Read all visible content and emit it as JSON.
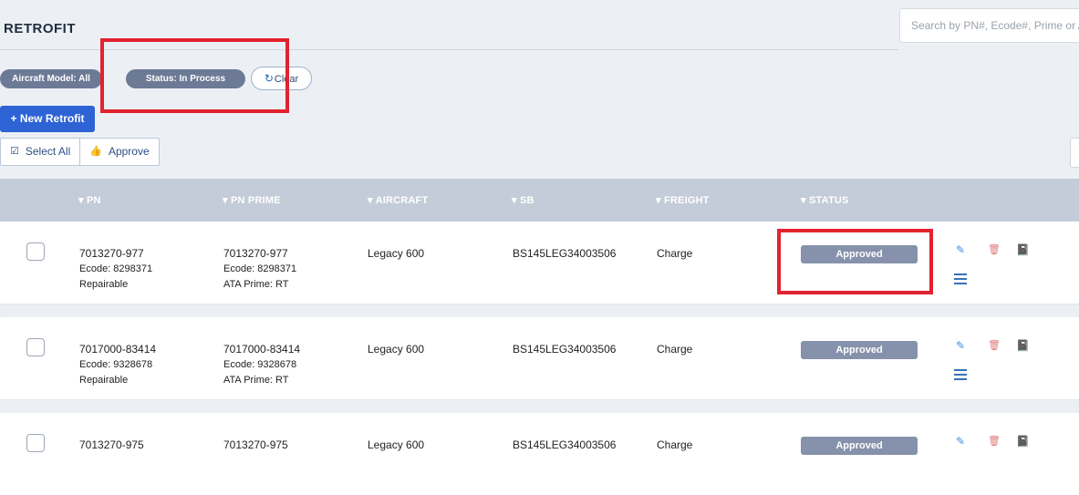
{
  "page_title": "RETROFIT",
  "search": {
    "placeholder": "Search by PN#, Ecode#, Prime or ATA..."
  },
  "filters": {
    "aircraft_model": "Aircraft Model: All",
    "status": "Status: In Process",
    "clear_label": "Clear"
  },
  "buttons": {
    "new_retrofit": "New Retrofit",
    "select_all": "Select All",
    "approve": "Approve"
  },
  "table": {
    "headers": [
      "PN",
      "PN PRIME",
      "AIRCRAFT",
      "SB",
      "FREIGHT",
      "STATUS"
    ],
    "rows": [
      {
        "pn": "7013270-977",
        "pn_ecode": "Ecode: 8298371",
        "pn_note": "Repairable",
        "prime": "7013270-977",
        "prime_ecode": "Ecode: 8298371",
        "prime_ata": "ATA Prime: RT",
        "aircraft": "Legacy 600",
        "sb": "BS145LEG34003506",
        "freight": "Charge",
        "status": "Approved"
      },
      {
        "pn": "7017000-83414",
        "pn_ecode": "Ecode: 9328678",
        "pn_note": "Repairable",
        "prime": "7017000-83414",
        "prime_ecode": "Ecode: 9328678",
        "prime_ata": "ATA Prime: RT",
        "aircraft": "Legacy 600",
        "sb": "BS145LEG34003506",
        "freight": "Charge",
        "status": "Approved"
      },
      {
        "pn": "7013270-975",
        "pn_ecode": "",
        "pn_note": "",
        "prime": "7013270-975",
        "prime_ecode": "",
        "prime_ata": "",
        "aircraft": "Legacy 600",
        "sb": "BS145LEG34003506",
        "freight": "Charge",
        "status": "Approved"
      }
    ]
  },
  "colors": {
    "primary_button": "#2d63d5",
    "status_chip": "#6c7a96",
    "approved_badge": "#8691ab",
    "table_header": "#c4ccda",
    "highlight": "#e3222f"
  }
}
